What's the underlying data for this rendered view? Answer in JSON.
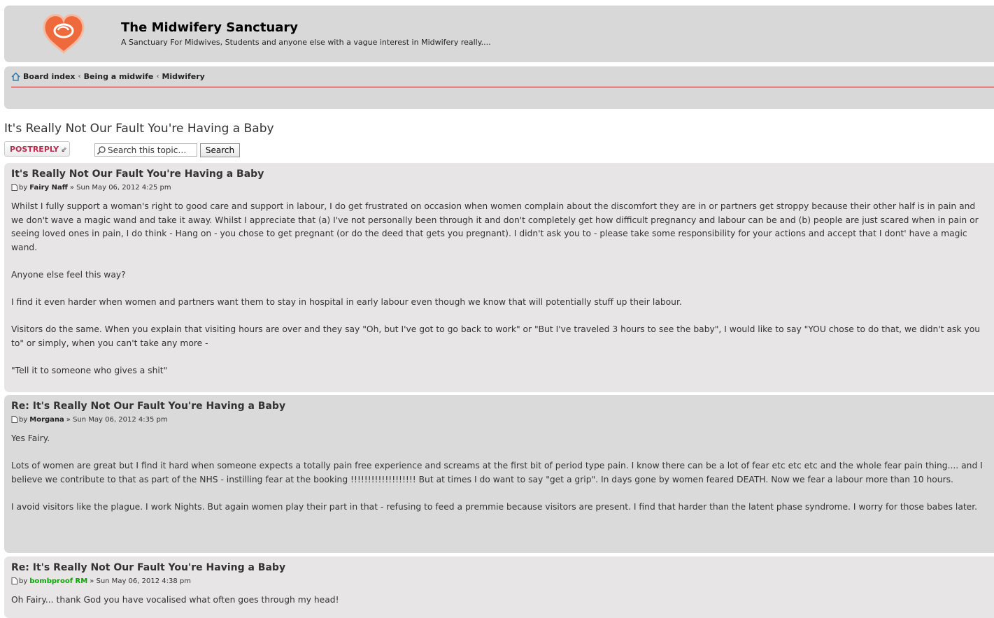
{
  "site": {
    "title": "The Midwifery Sanctuary",
    "description": "A Sanctuary For Midwives, Students and anyone else with a vague interest in Midwifery really....",
    "logo_icon": "heart-logo-icon"
  },
  "breadcrumb": {
    "items": [
      "Board index",
      "Being a midwife",
      "Midwifery"
    ],
    "separator": "‹"
  },
  "topic": {
    "title": "It's Really Not Our Fault You're Having a Baby",
    "post_reply_label": "POSTREPLY",
    "search_placeholder": "Search this topic…",
    "search_button": "Search"
  },
  "posts": [
    {
      "title": "It's Really Not Our Fault You're Having a Baby",
      "by": "by",
      "author": "Fairy Naff",
      "date": "» Sun May 06, 2012 4:25 pm",
      "paragraphs": [
        "Whilst I fully support a woman's right to good care and support in labour, I do get frustrated on occasion when women complain about the discomfort they are in or partners get stroppy because their other half is in pain and we don't wave a magic wand and take it away. Whilst I appreciate that (a) I've not personally been through it and don't completely get how difficult pregnancy and labour can be and (b) people are just scared when in pain or seeing loved ones in pain, I do think - Hang on - you chose to get pregnant (or do the deed that gets you pregnant). I didn't ask you to - please take some responsibility for your actions and accept that I dont' have a magic wand.",
        "Anyone else feel this way?",
        "I find it even harder when women and partners want them to stay in hospital in early labour even though we know that will potentially stuff up their labour.",
        "Visitors do the same. When you explain that visiting hours are over and they say \"Oh, but I've got to go back to work\" or \"But I've traveled 3 hours to see the baby\", I would like to say \"YOU chose to do that, we didn't ask you to\" or simply, when you can't take any more -",
        "\"Tell it to someone who gives a shit\""
      ]
    },
    {
      "title": "Re: It's Really Not Our Fault You're Having a Baby",
      "by": "by",
      "author": "Morgana",
      "date": "» Sun May 06, 2012 4:35 pm",
      "paragraphs": [
        "Yes Fairy.",
        "Lots of women are great but I find it hard when someone expects a totally pain free experience and screams at the first bit of period type pain. I know there can be a lot of fear etc etc etc and the whole fear pain thing.... and I believe we contribute to that as part of the NHS - instilling fear at the booking !!!!!!!!!!!!!!!!!!! But at times I do want to say \"get a grip\". In days gone by women feared DEATH. Now we fear a labour more than 10 hours.",
        "I avoid visitors like the plague. I work Nights. But again women play their part in that - refusing to feed a premmie because visitors are present. I find that harder than the latent phase syndrome. I worry for those babes later."
      ]
    },
    {
      "title": "Re: It's Really Not Our Fault You're Having a Baby",
      "by": "by",
      "author": "bombproof RM",
      "author_color": "#00aa00",
      "date": "» Sun May 06, 2012 4:38 pm",
      "paragraphs": [
        "Oh Fairy... thank God you have vocalised what often goes through my head!"
      ]
    }
  ],
  "colors": {
    "header_bg": "#d8d8d8",
    "post_bg_light": "#e7e5e6",
    "post_bg_dark": "#dadada",
    "accent_red": "#b31c1c",
    "post_reply_text": "#bc2a4d"
  }
}
